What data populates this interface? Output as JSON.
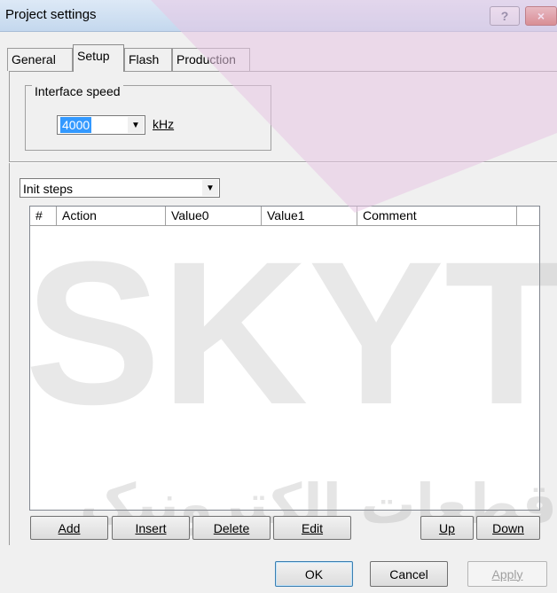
{
  "window": {
    "title": "Project settings",
    "help_label": "?",
    "close_label": "×"
  },
  "tabs": [
    {
      "label": "General"
    },
    {
      "label": "Setup"
    },
    {
      "label": "Flash"
    },
    {
      "label": "Production"
    }
  ],
  "interface_speed": {
    "group_label": "Interface speed",
    "value": "4000",
    "unit": "kHz"
  },
  "init_steps": {
    "selected": "Init steps"
  },
  "table": {
    "columns": [
      "#",
      "Action",
      "Value0",
      "Value1",
      "Comment"
    ],
    "rows": []
  },
  "actions": {
    "add": "Add",
    "insert": "Insert",
    "delete": "Delete",
    "edit": "Edit",
    "up": "Up",
    "down": "Down"
  },
  "footer": {
    "ok": "OK",
    "cancel": "Cancel",
    "apply": "Apply"
  },
  "watermark": {
    "latin": "SKYT",
    "arabic": "قطعات الکترونیک"
  },
  "colors": {
    "selection": "#3399ff",
    "close_button": "#c74b36",
    "watermark_pink": "#e8c6e4"
  }
}
